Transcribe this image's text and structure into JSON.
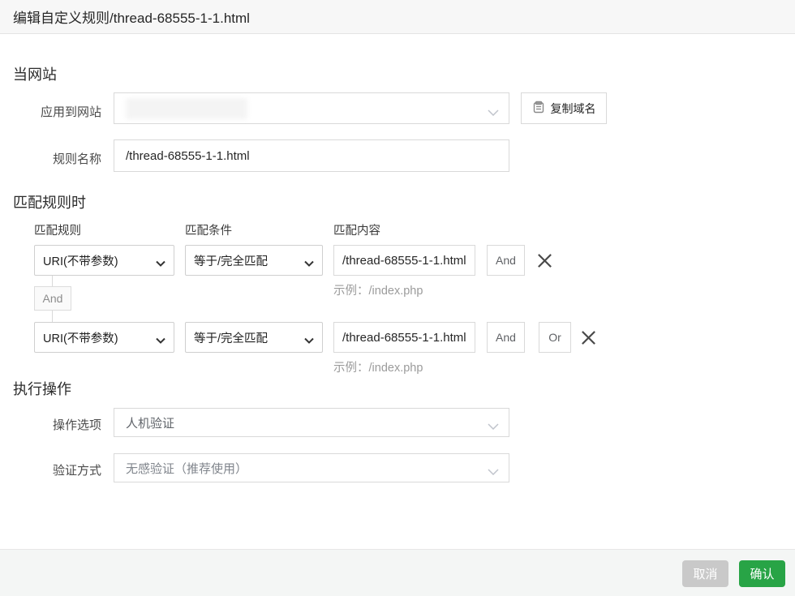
{
  "title": "编辑自定义规则/thread-68555-1-1.html",
  "site": {
    "heading": "当网站",
    "apply_label": "应用到网站",
    "copy_button_label": "复制域名",
    "rule_name_label": "规则名称",
    "rule_name_value": "/thread-68555-1-1.html"
  },
  "match": {
    "heading": "匹配规则时",
    "col_rule": "匹配规则",
    "col_condition": "匹配条件",
    "col_content": "匹配内容",
    "connector_label": "And",
    "rows": [
      {
        "rule": "URI(不带参数)",
        "condition": "等于/完全匹配",
        "content": "/thread-68555-1-1.html",
        "and_label": "And",
        "hint": "示例：/index.php"
      },
      {
        "rule": "URI(不带参数)",
        "condition": "等于/完全匹配",
        "content": "/thread-68555-1-1.html",
        "and_label": "And",
        "or_label": "Or",
        "hint": "示例：/index.php"
      }
    ]
  },
  "action": {
    "heading": "执行操作",
    "option_label": "操作选项",
    "option_value": "人机验证",
    "verify_label": "验证方式",
    "verify_value": "无感验证（推荐使用）"
  },
  "footer": {
    "cancel_label": "取消",
    "confirm_label": "确认"
  },
  "colors": {
    "confirm_green": "#28a446",
    "cancel_gray": "#c9c9c9",
    "field_border": "#d9d9d9",
    "header_bg": "#f7f7f7",
    "footer_bg": "#f4f6f5"
  }
}
